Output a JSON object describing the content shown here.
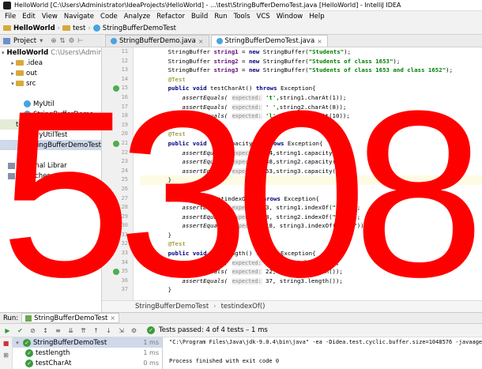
{
  "window": {
    "title": "HelloWorld [C:\\Users\\Administrator\\IdeaProjects\\HelloWorld] - ...\\test\\StringBufferDemoTest.java [HelloWorld] - IntelliJ IDEA"
  },
  "menu": [
    "File",
    "Edit",
    "View",
    "Navigate",
    "Code",
    "Analyze",
    "Refactor",
    "Build",
    "Run",
    "Tools",
    "VCS",
    "Window",
    "Help"
  ],
  "nav": {
    "project": "HelloWorld",
    "folder": "test",
    "class": "StringBufferDemoTest"
  },
  "project_tool": {
    "label": "Project"
  },
  "tabs": [
    {
      "label": "StringBufferDemo.java",
      "active": false
    },
    {
      "label": "StringBufferDemoTest.java",
      "active": true
    }
  ],
  "tree": [
    {
      "label": "HelloWorld",
      "extra": "C:\\Users\\Administ",
      "indent": 0,
      "icon": "folder-icon",
      "expanded": true,
      "bold": true
    },
    {
      "label": ".idea",
      "indent": 1,
      "icon": "folder-icon",
      "expanded": false
    },
    {
      "label": "out",
      "indent": 1,
      "icon": "folder-icon",
      "expanded": false
    },
    {
      "label": "src",
      "indent": 1,
      "icon": "folder-icon",
      "expanded": true
    },
    {
      "label": "",
      "indent": 2,
      "icon": "",
      "expanded": null
    },
    {
      "label": "MyUtil",
      "indent": 2,
      "icon": "class-icon"
    },
    {
      "label": "StringBufferDemo",
      "indent": 2,
      "icon": "class-icon"
    },
    {
      "label": "test",
      "indent": 1,
      "icon": "",
      "highlight": true
    },
    {
      "label": "MyUtilTest",
      "indent": 2,
      "icon": "class-icon"
    },
    {
      "label": "StringBufferDemoTest",
      "indent": 2,
      "icon": "class-icon",
      "selected": true
    },
    {
      "label": "",
      "indent": 1,
      "icon": ""
    },
    {
      "label": "External Librar",
      "indent": 0,
      "icon": "library-icon"
    },
    {
      "label": "Scratches and Con",
      "indent": 0,
      "icon": "scratch-icon"
    }
  ],
  "editor": {
    "line_numbers": [
      "11",
      "12",
      "13",
      "14",
      "15",
      "16",
      "17",
      "18",
      "19",
      "20",
      "21",
      "22",
      "23",
      "24",
      "25",
      "26",
      "27",
      "28",
      "29",
      "30",
      "31",
      "32",
      "33",
      "34",
      "35",
      "36",
      "37"
    ],
    "run_marks": [
      4,
      10,
      17,
      24
    ]
  },
  "code": [
    {
      "p": [
        {
          "t": "        StringBuffer ",
          "c": ""
        },
        {
          "t": "string1",
          "c": "b"
        },
        {
          "t": " = ",
          "c": ""
        },
        {
          "t": "new",
          "c": "kw"
        },
        {
          "t": " StringBuffer(",
          "c": ""
        },
        {
          "t": "\"Students\"",
          "c": "str"
        },
        {
          "t": ");",
          "c": ""
        }
      ]
    },
    {
      "p": [
        {
          "t": "        StringBuffer ",
          "c": ""
        },
        {
          "t": "string2",
          "c": "b"
        },
        {
          "t": " = ",
          "c": ""
        },
        {
          "t": "new",
          "c": "kw"
        },
        {
          "t": " StringBuffer(",
          "c": ""
        },
        {
          "t": "\"Students of class 1653\"",
          "c": "str"
        },
        {
          "t": ");",
          "c": ""
        }
      ]
    },
    {
      "p": [
        {
          "t": "        StringBuffer ",
          "c": ""
        },
        {
          "t": "string3",
          "c": "b"
        },
        {
          "t": " = ",
          "c": ""
        },
        {
          "t": "new",
          "c": "kw"
        },
        {
          "t": " StringBuffer(",
          "c": ""
        },
        {
          "t": "\"Students of class 1653 and class 1652\"",
          "c": "str"
        },
        {
          "t": ");",
          "c": ""
        }
      ]
    },
    {
      "p": [
        {
          "t": "        @Test",
          "c": "ann"
        }
      ]
    },
    {
      "p": [
        {
          "t": "        ",
          "c": ""
        },
        {
          "t": "public void",
          "c": "kw"
        },
        {
          "t": " testCharAt() ",
          "c": ""
        },
        {
          "t": "throws",
          "c": "kw"
        },
        {
          "t": " Exception{",
          "c": ""
        }
      ]
    },
    {
      "p": [
        {
          "t": "            assertEquals( ",
          "c": "it"
        },
        {
          "t": "expected:",
          "c": "hint"
        },
        {
          "t": " 't',",
          "c": "str"
        },
        {
          "t": "string1.charAt(1));",
          "c": ""
        }
      ]
    },
    {
      "p": [
        {
          "t": "            assertEquals( ",
          "c": "it"
        },
        {
          "t": "expected:",
          "c": "hint"
        },
        {
          "t": " ' ',",
          "c": "str"
        },
        {
          "t": "string2.charAt(8));",
          "c": ""
        }
      ]
    },
    {
      "p": [
        {
          "t": "            assertEquals( ",
          "c": "it"
        },
        {
          "t": "expected:",
          "c": "hint"
        },
        {
          "t": " 'l',",
          "c": "str"
        },
        {
          "t": "string3.charAt(10));",
          "c": ""
        }
      ]
    },
    {
      "p": [
        {
          "t": "        }",
          "c": ""
        }
      ]
    },
    {
      "p": [
        {
          "t": "        @Test",
          "c": "ann"
        }
      ]
    },
    {
      "p": [
        {
          "t": "        ",
          "c": ""
        },
        {
          "t": "public void",
          "c": "kw"
        },
        {
          "t": " testCapacity() ",
          "c": ""
        },
        {
          "t": "throws",
          "c": "kw"
        },
        {
          "t": " Exception{",
          "c": ""
        }
      ]
    },
    {
      "p": [
        {
          "t": "            assertEquals( ",
          "c": "it"
        },
        {
          "t": "expected:",
          "c": "hint"
        },
        {
          "t": " 24,string1.capacity());",
          "c": ""
        }
      ]
    },
    {
      "p": [
        {
          "t": "            assertEquals( ",
          "c": "it"
        },
        {
          "t": "expected:",
          "c": "hint"
        },
        {
          "t": " 38,string2.capacity());",
          "c": ""
        }
      ]
    },
    {
      "p": [
        {
          "t": "            assertEquals( ",
          "c": "it"
        },
        {
          "t": "expected:",
          "c": "hint"
        },
        {
          "t": " 53,string3.capacity());",
          "c": ""
        }
      ]
    },
    {
      "p": [
        {
          "t": "        }",
          "c": ""
        }
      ],
      "cur": true
    },
    {
      "p": [
        {
          "t": "        @Test",
          "c": "ann"
        }
      ]
    },
    {
      "p": [
        {
          "t": "        ",
          "c": ""
        },
        {
          "t": "public void",
          "c": "kw"
        },
        {
          "t": " testindexOf() ",
          "c": ""
        },
        {
          "t": "throws",
          "c": "kw"
        },
        {
          "t": " Exception{",
          "c": ""
        }
      ]
    },
    {
      "p": [
        {
          "t": "            assertEquals( ",
          "c": "it"
        },
        {
          "t": "expected:",
          "c": "hint"
        },
        {
          "t": " 3, string1.indexOf(",
          "c": ""
        },
        {
          "t": "\"tud\"",
          "c": "str"
        },
        {
          "t": "));",
          "c": ""
        }
      ]
    },
    {
      "p": [
        {
          "t": "            assertEquals( ",
          "c": "it"
        },
        {
          "t": "expected:",
          "c": "hint"
        },
        {
          "t": " 8, string2.indexOf(",
          "c": ""
        },
        {
          "t": "\" of\"",
          "c": "str"
        },
        {
          "t": "));",
          "c": ""
        }
      ]
    },
    {
      "p": [
        {
          "t": "            assertEquals( ",
          "c": "it"
        },
        {
          "t": "expected:",
          "c": "hint"
        },
        {
          "t": " 18, string3.indexOf(",
          "c": ""
        },
        {
          "t": "\"1653\"",
          "c": "str"
        },
        {
          "t": "));",
          "c": ""
        }
      ]
    },
    {
      "p": [
        {
          "t": "        }",
          "c": ""
        }
      ]
    },
    {
      "p": [
        {
          "t": "        @Test",
          "c": "ann"
        }
      ]
    },
    {
      "p": [
        {
          "t": "        ",
          "c": ""
        },
        {
          "t": "public void",
          "c": "kw"
        },
        {
          "t": " testlength() ",
          "c": ""
        },
        {
          "t": "throws",
          "c": "kw"
        },
        {
          "t": " Exception{",
          "c": ""
        }
      ]
    },
    {
      "p": [
        {
          "t": "            assertEquals( ",
          "c": "it"
        },
        {
          "t": "expected:",
          "c": "hint"
        },
        {
          "t": " 8, string1.length());",
          "c": ""
        }
      ]
    },
    {
      "p": [
        {
          "t": "            assertEquals( ",
          "c": "it"
        },
        {
          "t": "expected:",
          "c": "hint"
        },
        {
          "t": " 22, string2.length());",
          "c": ""
        }
      ]
    },
    {
      "p": [
        {
          "t": "            assertEquals( ",
          "c": "it"
        },
        {
          "t": "expected:",
          "c": "hint"
        },
        {
          "t": " 37, string3.length());",
          "c": ""
        }
      ]
    },
    {
      "p": [
        {
          "t": "        }",
          "c": ""
        }
      ]
    }
  ],
  "breadcrumb": {
    "cls": "StringBufferDemoTest",
    "method": "testindexOf()"
  },
  "run": {
    "label": "Run:",
    "config": "StringBufferDemoTest",
    "status": "Tests passed: 4 of 4 tests – 1 ms"
  },
  "results": [
    {
      "label": "StringBufferDemoTest",
      "time": "1 ms",
      "indent": 0,
      "selected": true
    },
    {
      "label": "testlength",
      "time": "1 ms",
      "indent": 1
    },
    {
      "label": "testCharAt",
      "time": "0 ms",
      "indent": 1
    }
  ],
  "console": [
    "\"C:\\Program Files\\Java\\jdk-9.0.4\\bin\\java\" -ea -Didea.test.cyclic.buffer.size=1048576 -javaagent:C:\\Program",
    "",
    "Process finished with exit code 0"
  ],
  "overlay": {
    "text": "5308",
    "color": "#ff0000"
  }
}
